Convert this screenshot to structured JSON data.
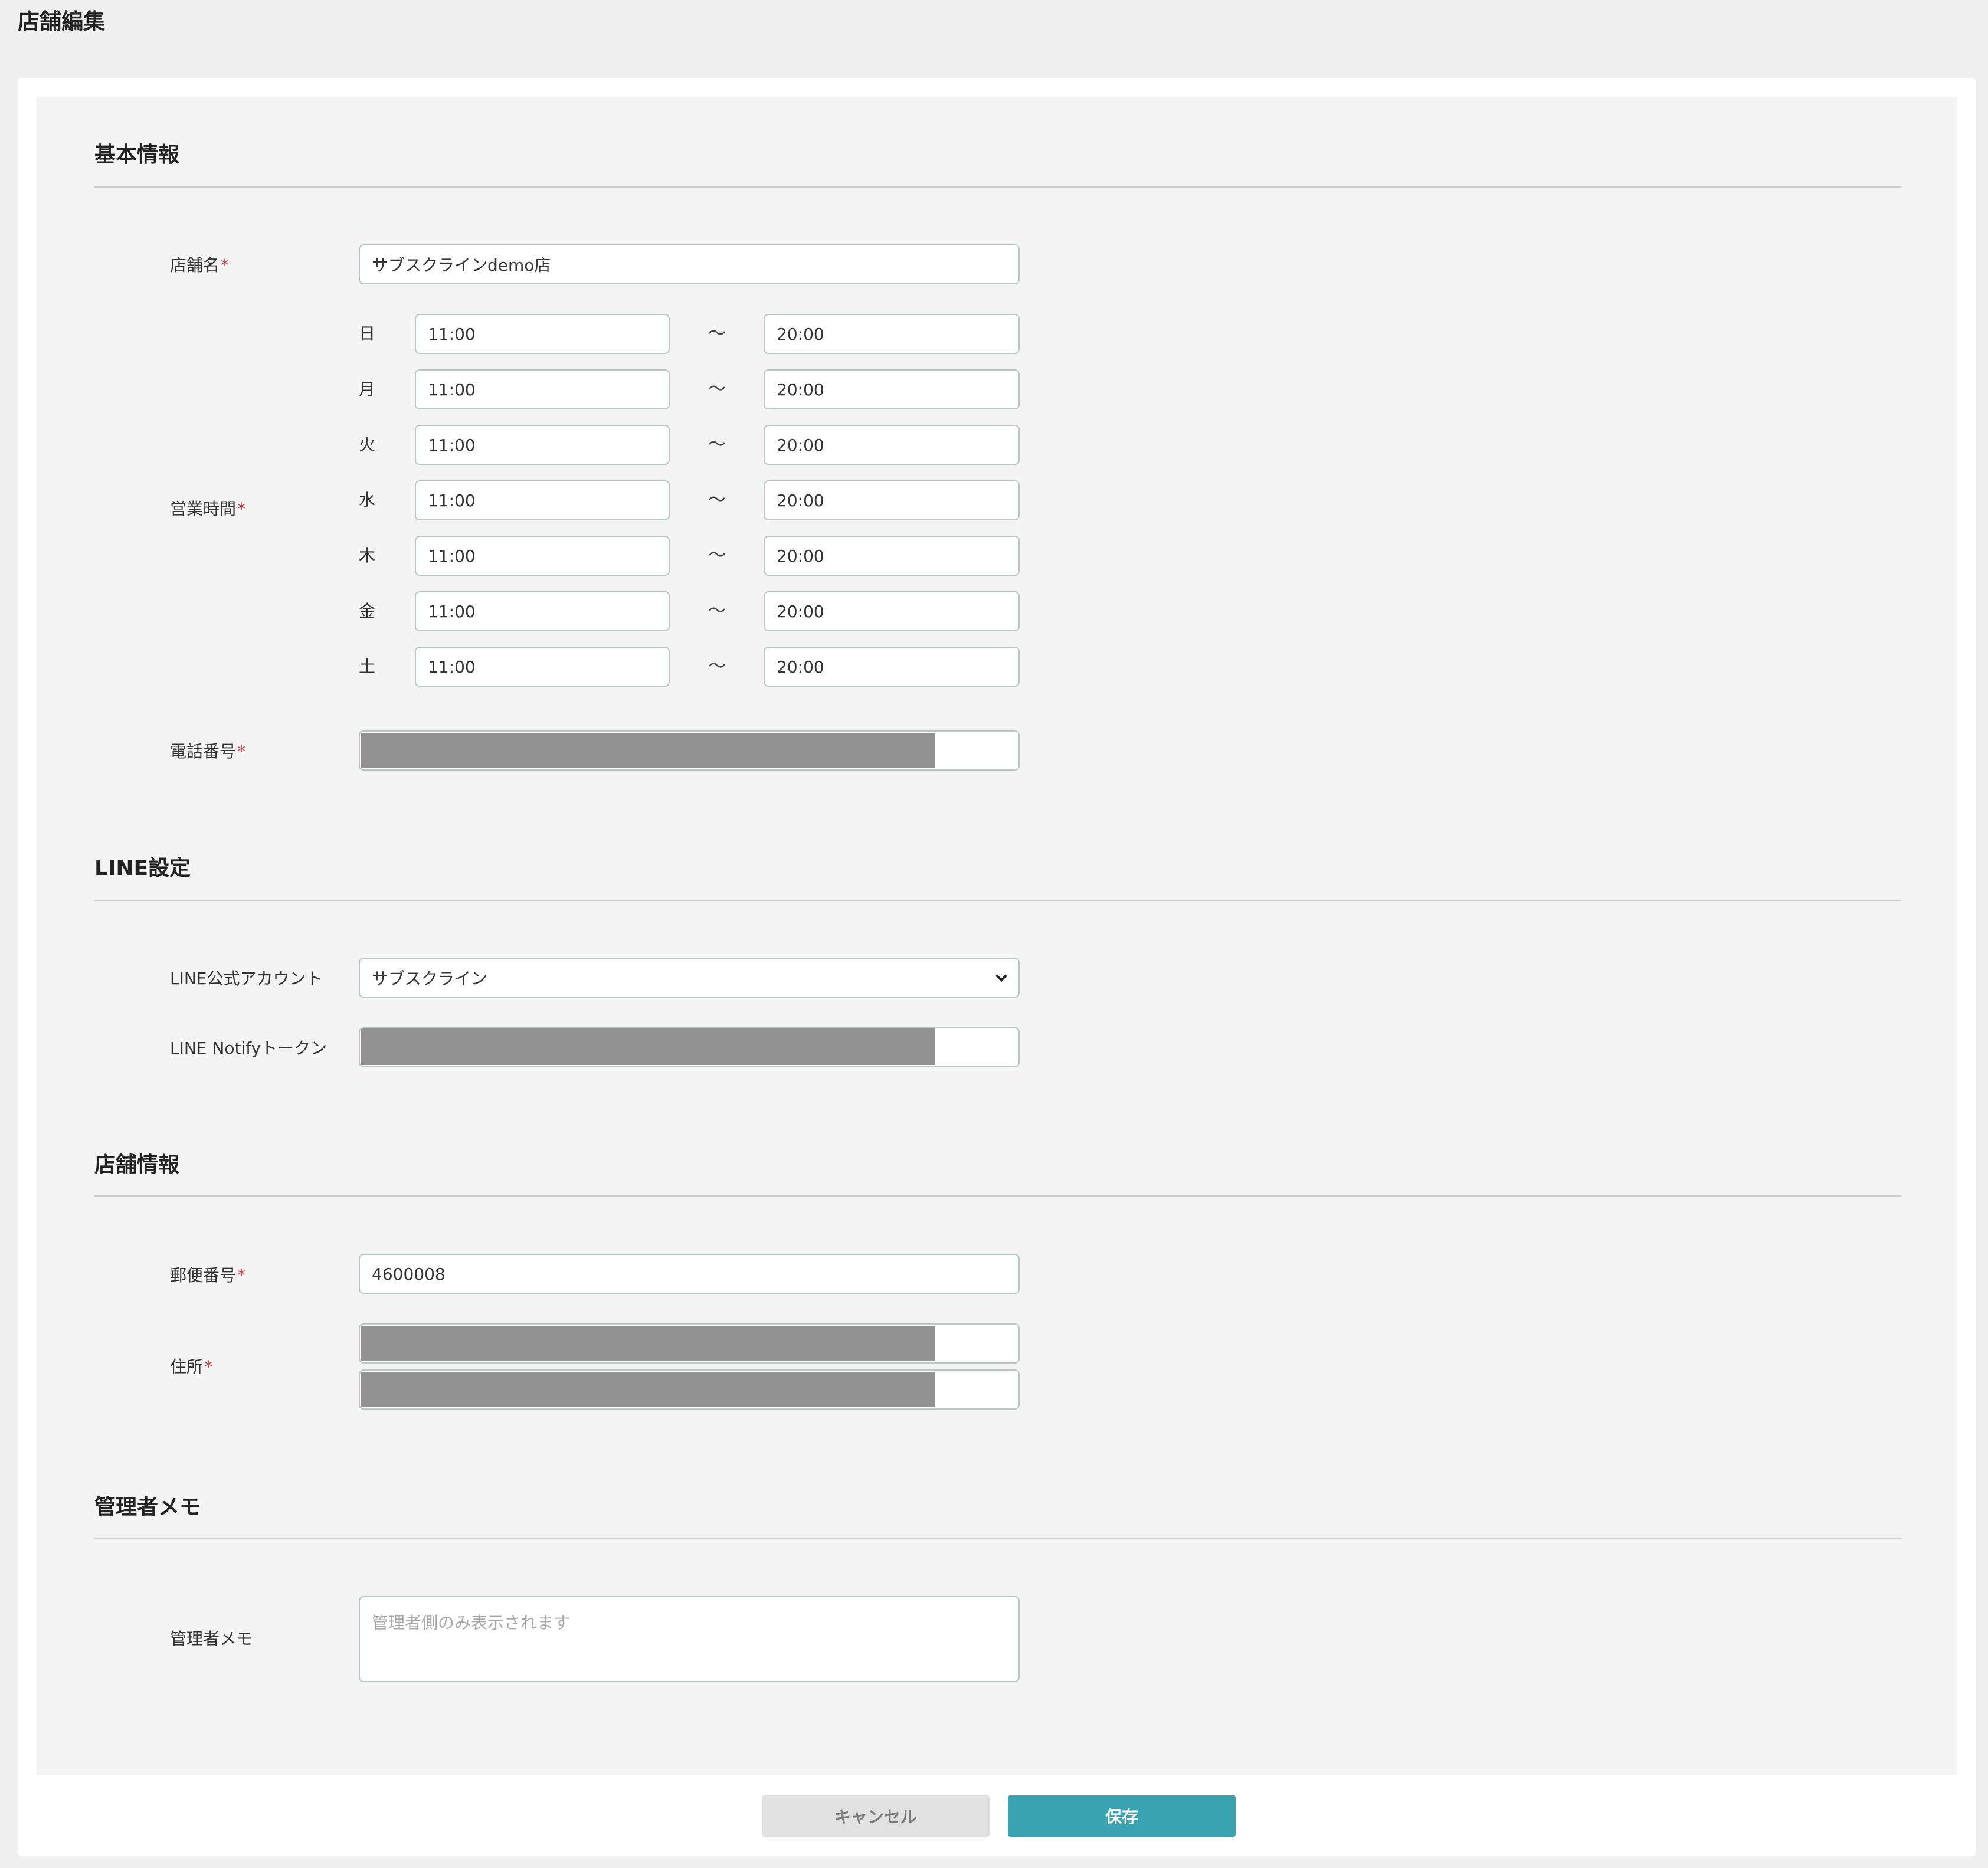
{
  "page_title": "店舗編集",
  "sections": {
    "basic": {
      "title": "基本情報",
      "store_name_label": "店舗名",
      "store_name_value": "サブスクラインdemo店",
      "hours_label": "営業時間",
      "hours": [
        {
          "day": "日",
          "open": "11:00",
          "close": "20:00"
        },
        {
          "day": "月",
          "open": "11:00",
          "close": "20:00"
        },
        {
          "day": "火",
          "open": "11:00",
          "close": "20:00"
        },
        {
          "day": "水",
          "open": "11:00",
          "close": "20:00"
        },
        {
          "day": "木",
          "open": "11:00",
          "close": "20:00"
        },
        {
          "day": "金",
          "open": "11:00",
          "close": "20:00"
        },
        {
          "day": "土",
          "open": "11:00",
          "close": "20:00"
        }
      ],
      "tilde": "〜",
      "phone_label": "電話番号"
    },
    "line": {
      "title": "LINE設定",
      "account_label": "LINE公式アカウント",
      "account_value": "サブスクライン",
      "notify_label": "LINE Notifyトークン"
    },
    "store_info": {
      "title": "店舗情報",
      "postal_label": "郵便番号",
      "postal_value": "4600008",
      "address_label": "住所"
    },
    "memo": {
      "title": "管理者メモ",
      "memo_label": "管理者メモ",
      "memo_placeholder": "管理者側のみ表示されます"
    }
  },
  "required_mark": "*",
  "buttons": {
    "cancel": "キャンセル",
    "save": "保存"
  },
  "colors": {
    "accent": "#3aa3b1",
    "required": "#d0363c",
    "redacted": "#929292"
  }
}
